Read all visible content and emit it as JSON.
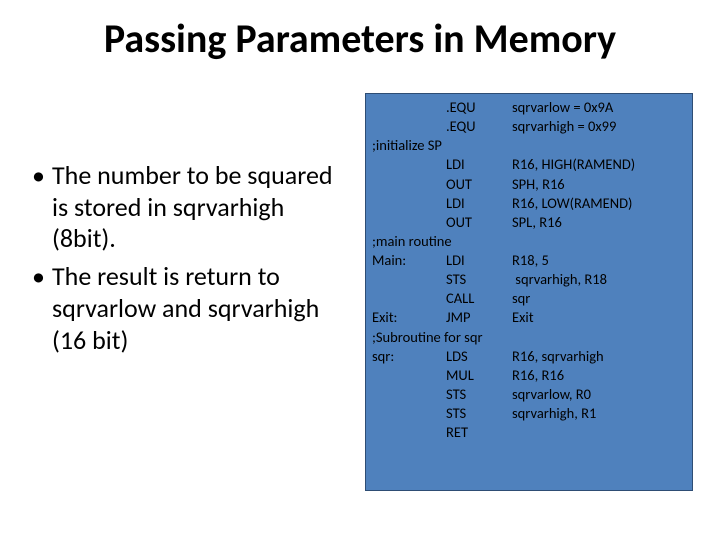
{
  "title": "Passing Parameters in Memory",
  "bullets": [
    "The number to be squared is stored in sqrvarhigh (8bit).",
    "The result is return to sqrvarlow and sqrvarhigh (16 bit)"
  ],
  "code": [
    {
      "label": "",
      "op": ".EQU",
      "arg": "sqrvarlow = 0x9A"
    },
    {
      "label": "",
      "op": ".EQU",
      "arg": "sqrvarhigh = 0x99"
    },
    {
      "full": ";initialize SP"
    },
    {
      "label": "",
      "op": "LDI",
      "arg": "R16, HIGH(RAMEND)"
    },
    {
      "label": "",
      "op": "OUT",
      "arg": "SPH, R16"
    },
    {
      "label": "",
      "op": "LDI",
      "arg": "R16, LOW(RAMEND)"
    },
    {
      "label": "",
      "op": "OUT",
      "arg": "SPL, R16"
    },
    {
      "full": ";main routine"
    },
    {
      "label": "Main:",
      "op": "LDI",
      "arg": "R18, 5"
    },
    {
      "label": "",
      "op": "STS",
      "arg": " sqrvarhigh, R18"
    },
    {
      "label": "",
      "op": "CALL",
      "arg": "sqr"
    },
    {
      "label": "Exit:",
      "op": "JMP",
      "arg": "Exit"
    },
    {
      "full": ";Subroutine for sqr"
    },
    {
      "label": "sqr:",
      "op": "LDS",
      "arg": "R16, sqrvarhigh"
    },
    {
      "label": "",
      "op": "MUL",
      "arg": "R16, R16"
    },
    {
      "label": "",
      "op": "STS",
      "arg": "sqrvarlow, R0"
    },
    {
      "label": "",
      "op": "STS",
      "arg": "sqrvarhigh, R1"
    },
    {
      "label": "",
      "op": "RET",
      "arg": ""
    }
  ]
}
